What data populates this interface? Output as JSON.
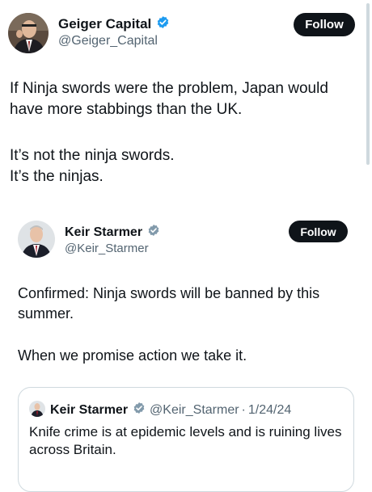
{
  "tweet": {
    "author": {
      "name": "Geiger Capital",
      "handle": "@Geiger_Capital",
      "verified_color": "#1d9bf0"
    },
    "follow_label": "Follow",
    "paragraphs": [
      "If Ninja swords were the problem, Japan would\nhave more stabbings than the UK.",
      "It’s not the ninja swords.\nIt’s the ninjas."
    ]
  },
  "quoted_tweet": {
    "author": {
      "name": "Keir Starmer",
      "handle": "@Keir_Starmer",
      "verified_color": "#829aab"
    },
    "follow_label": "Follow",
    "paragraphs": [
      "Confirmed: Ninja swords will be banned by this\nsummer.",
      "When we promise action we take it."
    ],
    "nested_quote": {
      "author_name": "Keir Starmer",
      "handle": "@Keir_Starmer",
      "separator": "·",
      "date": "1/24/24",
      "text": "Knife crime is at epidemic levels and is ruining lives\nacross Britain."
    }
  }
}
